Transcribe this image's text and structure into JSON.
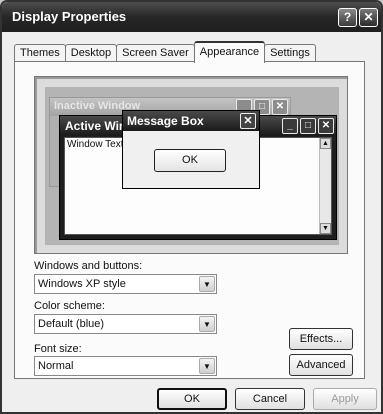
{
  "window": {
    "title": "Display Properties",
    "help_button": "?",
    "close_button": "✕"
  },
  "tabs": [
    {
      "label": "Themes"
    },
    {
      "label": "Desktop"
    },
    {
      "label": "Screen Saver"
    },
    {
      "label": "Appearance",
      "active": true
    },
    {
      "label": "Settings"
    }
  ],
  "preview": {
    "inactive_title": "Inactive Window",
    "active_title": "Active Window",
    "window_text": "Window Text",
    "message_box_title": "Message Box",
    "ok_label": "OK",
    "caption_buttons": {
      "min": "_",
      "max": "□",
      "close": "✕"
    }
  },
  "form": {
    "windows_buttons_label": "Windows and buttons:",
    "windows_buttons_value": "Windows XP style",
    "color_scheme_label": "Color scheme:",
    "color_scheme_value": "Default (blue)",
    "font_size_label": "Font size:",
    "font_size_value": "Normal",
    "effects_button": "Effects...",
    "advanced_button": "Advanced"
  },
  "footer": {
    "ok": "OK",
    "cancel": "Cancel",
    "apply": "Apply"
  }
}
